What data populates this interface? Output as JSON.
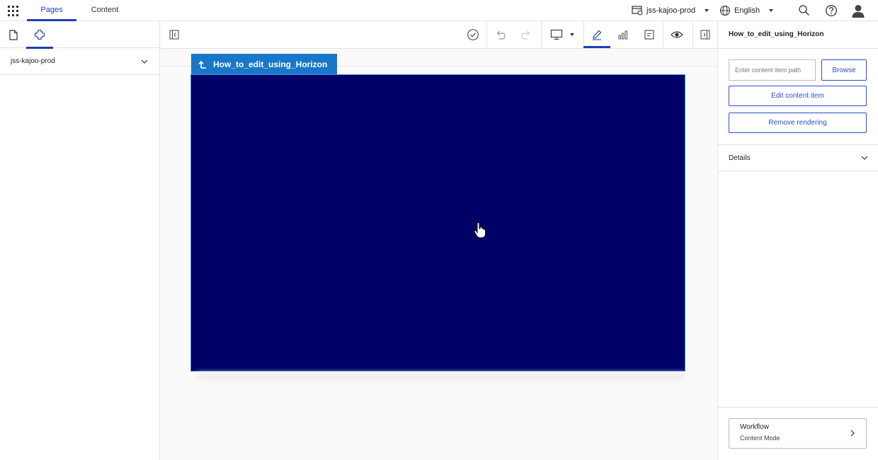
{
  "topbar": {
    "tabs": [
      {
        "label": "Pages",
        "active": true
      },
      {
        "label": "Content",
        "active": false
      }
    ],
    "site": "jss-kajoo-prod",
    "language": "English",
    "icons": [
      "apps-grid-icon",
      "site-icon",
      "globe-icon",
      "search-icon",
      "help-icon",
      "user-avatar-icon"
    ]
  },
  "left_panel": {
    "tabs": [
      {
        "icon": "page-icon",
        "active": false
      },
      {
        "icon": "components-icon",
        "active": true
      }
    ],
    "site_tree_root": "jss-kajoo-prod"
  },
  "toolbar": {
    "icons": [
      "collapse-left-panel-icon",
      "publish-check-icon",
      "undo-icon",
      "redo-icon",
      "device-desktop-icon",
      "edit-pencil-icon",
      "analytics-icon",
      "page-details-icon",
      "preview-eye-icon",
      "collapse-right-panel-icon"
    ],
    "active": "edit-pencil-icon"
  },
  "canvas": {
    "rendering_chip_label": "How_to_edit_using_Horizon",
    "rendering_color": "#000066"
  },
  "right_panel": {
    "title": "How_to_edit_using_Horizon",
    "path_placeholder": "Enter content item path",
    "browse_label": "Browse",
    "edit_label": "Edit content item",
    "remove_label": "Remove rendering",
    "details_label": "Details",
    "workflow_title": "Workflow",
    "workflow_state": "Content Mode"
  },
  "colors": {
    "accent": "#1f3fb5",
    "chip": "#1877c8",
    "button": "#2b4ed0"
  }
}
